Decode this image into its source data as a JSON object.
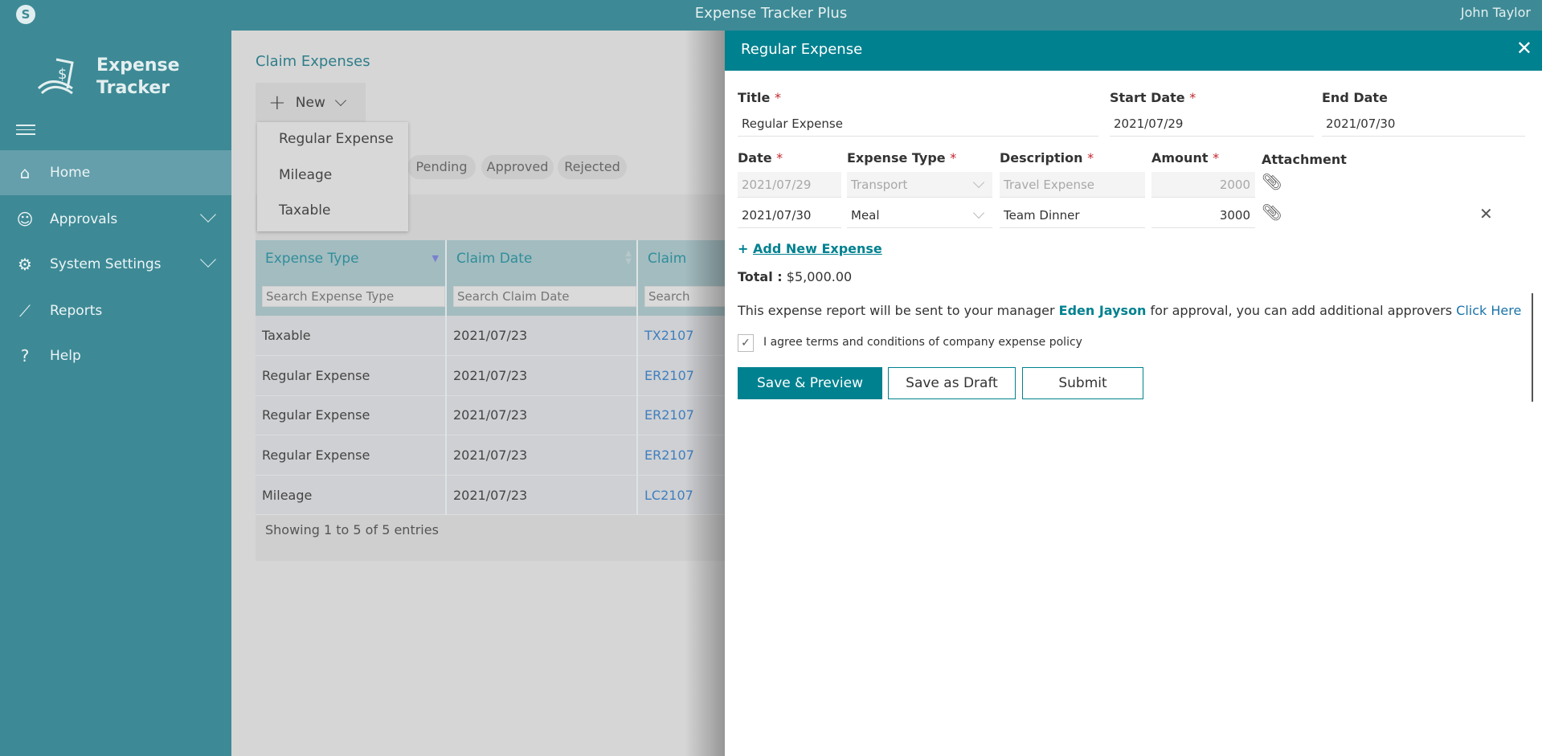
{
  "topbar": {
    "app_title": "Expense Tracker Plus",
    "user": "John Taylor",
    "app_icon": "sharepoint-icon"
  },
  "sidebar": {
    "logo": {
      "line1": "Expense",
      "line2": "Tracker"
    },
    "items": [
      {
        "label": "Home",
        "icon": "home-icon",
        "active": true
      },
      {
        "label": "Approvals",
        "icon": "user-check-icon",
        "expandable": true
      },
      {
        "label": "System Settings",
        "icon": "gear-icon",
        "expandable": true
      },
      {
        "label": "Reports",
        "icon": "chart-icon"
      },
      {
        "label": "Help",
        "icon": "question-icon"
      }
    ]
  },
  "main": {
    "title": "Claim Expenses",
    "new_button": "New",
    "new_menu": [
      "Regular Expense",
      "Mileage",
      "Taxable"
    ],
    "filters": [
      "Pending",
      "Approved",
      "Rejected"
    ],
    "table": {
      "columns": [
        "Expense Type",
        "Claim Date",
        "Claim"
      ],
      "search_placeholders": [
        "Search Expense Type",
        "Search Claim Date",
        "Search"
      ],
      "rows": [
        [
          "Taxable",
          "2021/07/23",
          "TX2107"
        ],
        [
          "Regular Expense",
          "2021/07/23",
          "ER2107"
        ],
        [
          "Regular Expense",
          "2021/07/23",
          "ER2107"
        ],
        [
          "Regular Expense",
          "2021/07/23",
          "ER2107"
        ],
        [
          "Mileage",
          "2021/07/23",
          "LC2107"
        ]
      ],
      "footer": "Showing 1 to 5 of 5 entries"
    }
  },
  "panel": {
    "header": "Regular Expense",
    "title_label": "Title",
    "title_value": "Regular Expense",
    "start_label": "Start Date",
    "start_value": "2021/07/29",
    "end_label": "End Date",
    "end_value": "2021/07/30",
    "cols": [
      "Date",
      "Expense Type",
      "Description",
      "Amount",
      "Attachment"
    ],
    "lines": [
      {
        "date": "2021/07/29",
        "type": "Transport",
        "desc": "Travel Expense",
        "amount": "2000",
        "disabled": true
      },
      {
        "date": "2021/07/30",
        "type": "Meal",
        "desc": "Team Dinner",
        "amount": "3000",
        "disabled": false
      }
    ],
    "add_new": "Add New Expense",
    "total_label": "Total :",
    "total_value": "$5,000.00",
    "msg_pre": "This expense report will be sent to your manager ",
    "manager": "Eden Jayson",
    "msg_mid": " for approval, you can add additional approvers ",
    "click_here": "Click Here",
    "agree": "I agree terms and conditions of company expense policy",
    "agree_checked": true,
    "buttons": {
      "save_preview": "Save & Preview",
      "draft": "Save as Draft",
      "submit": "Submit"
    },
    "colors": {
      "accent": "#00818f",
      "required": "#c4262e"
    }
  }
}
